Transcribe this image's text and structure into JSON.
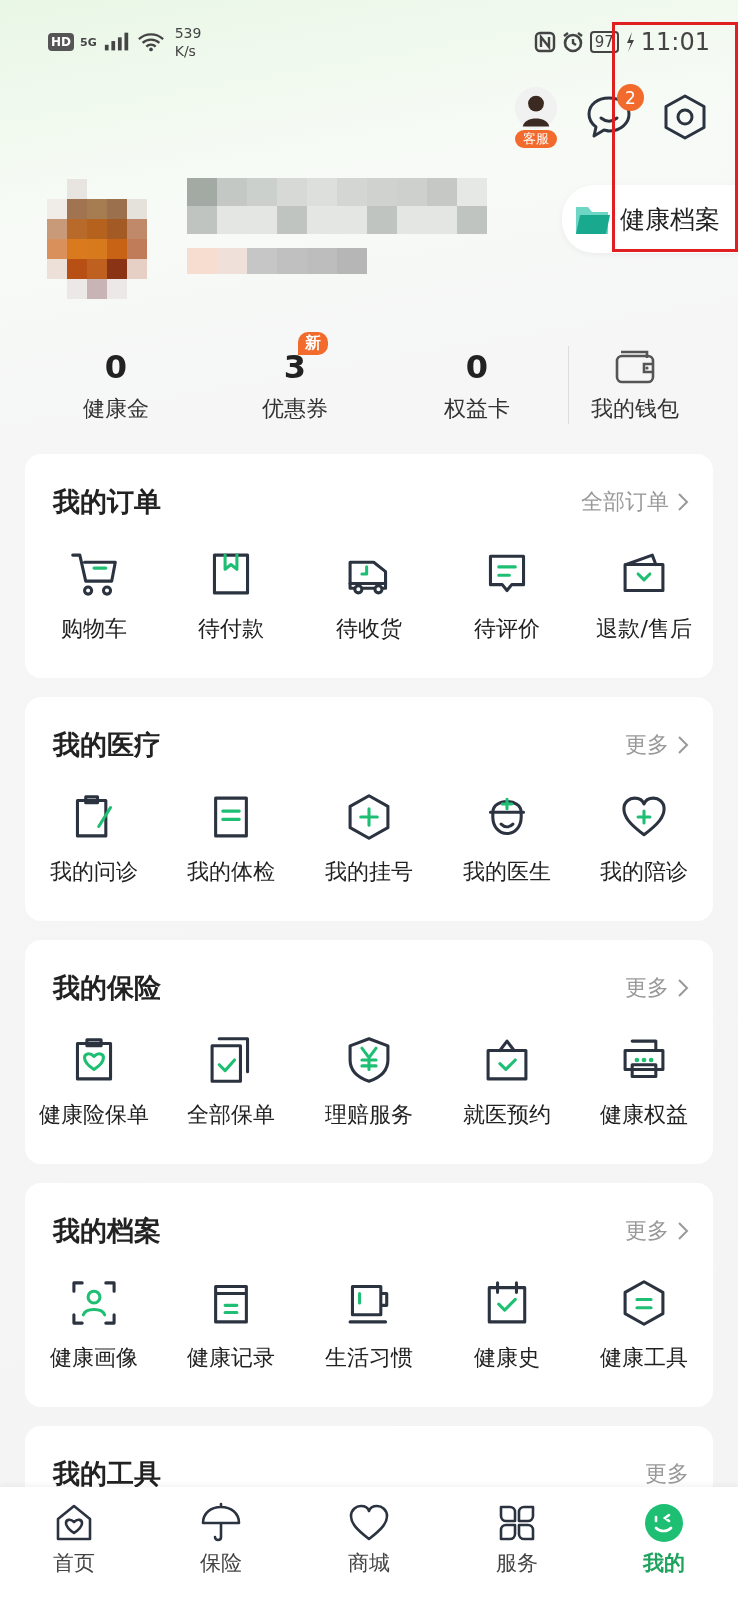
{
  "status_bar": {
    "hd": "HD",
    "net_type": "5G",
    "speed_value": "539",
    "speed_unit": "K/s",
    "battery": "97",
    "time": "11:01"
  },
  "header": {
    "service_label": "客服",
    "message_badge": "2",
    "record_button": "健康档案"
  },
  "stats": [
    {
      "value": "0",
      "label": "健康金"
    },
    {
      "value": "3",
      "label": "优惠券",
      "badge": "新"
    },
    {
      "value": "0",
      "label": "权益卡"
    }
  ],
  "wallet": {
    "label": "我的钱包"
  },
  "sections": [
    {
      "title": "我的订单",
      "more": "全部订单",
      "items": [
        "购物车",
        "待付款",
        "待收货",
        "待评价",
        "退款/售后"
      ]
    },
    {
      "title": "我的医疗",
      "more": "更多",
      "items": [
        "我的问诊",
        "我的体检",
        "我的挂号",
        "我的医生",
        "我的陪诊"
      ]
    },
    {
      "title": "我的保险",
      "more": "更多",
      "items": [
        "健康险保单",
        "全部保单",
        "理赔服务",
        "就医预约",
        "健康权益"
      ]
    },
    {
      "title": "我的档案",
      "more": "更多",
      "items": [
        "健康画像",
        "健康记录",
        "生活习惯",
        "健康史",
        "健康工具"
      ]
    }
  ],
  "partial_section": {
    "title": "我的工具",
    "more": "更多"
  },
  "nav": [
    {
      "label": "首页",
      "selected": false
    },
    {
      "label": "保险",
      "selected": false
    },
    {
      "label": "商城",
      "selected": false
    },
    {
      "label": "服务",
      "selected": false
    },
    {
      "label": "我的",
      "selected": true
    }
  ]
}
